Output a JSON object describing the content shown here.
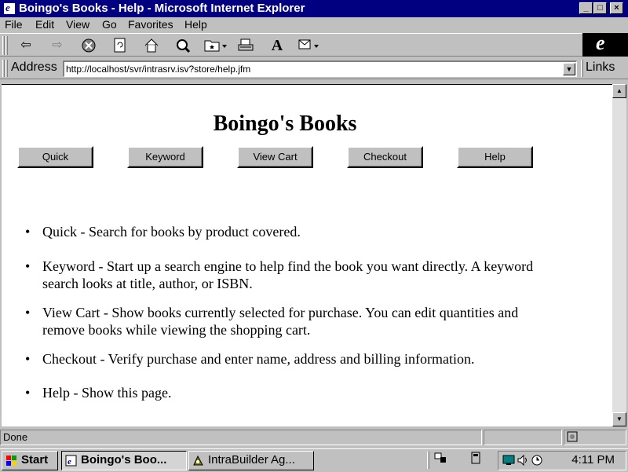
{
  "window": {
    "title": "Boingo's Books - Help - Microsoft Internet Explorer",
    "controls": {
      "minimize": "_",
      "maximize": "□",
      "close": "×"
    }
  },
  "menu": [
    "File",
    "Edit",
    "View",
    "Go",
    "Favorites",
    "Help"
  ],
  "toolbar_icons": [
    "back-icon",
    "forward-icon",
    "stop-icon",
    "refresh-icon",
    "home-icon",
    "search-icon",
    "favorites-icon",
    "print-icon",
    "font-icon",
    "mail-icon"
  ],
  "address": {
    "label": "Address",
    "url": "http://localhost/svr/intrasrv.isv?store/help.jfm",
    "links_label": "Links"
  },
  "page": {
    "title": "Boingo's Books",
    "nav_buttons": [
      "Quick",
      "Keyword",
      "View Cart",
      "Checkout",
      "Help"
    ],
    "help_items": [
      "Quick - Search for books by product covered.",
      "Keyword - Start up a search engine to help find the book you want directly. A keyword search looks at title, author, or ISBN.",
      "View Cart - Show books currently selected for purchase. You can edit quantities and remove books while viewing the shopping cart.",
      "Checkout - Verify purchase and enter name, address and billing information.",
      "Help - Show this page."
    ]
  },
  "status": {
    "text": "Done"
  },
  "taskbar": {
    "start": "Start",
    "tasks": [
      "Boingo's Boo...",
      "IntraBuilder Ag..."
    ],
    "clock": "4:11 PM"
  },
  "colors": {
    "titlebar": "#000080",
    "chrome": "#c0c0c0",
    "content_bg": "#ffffff"
  }
}
